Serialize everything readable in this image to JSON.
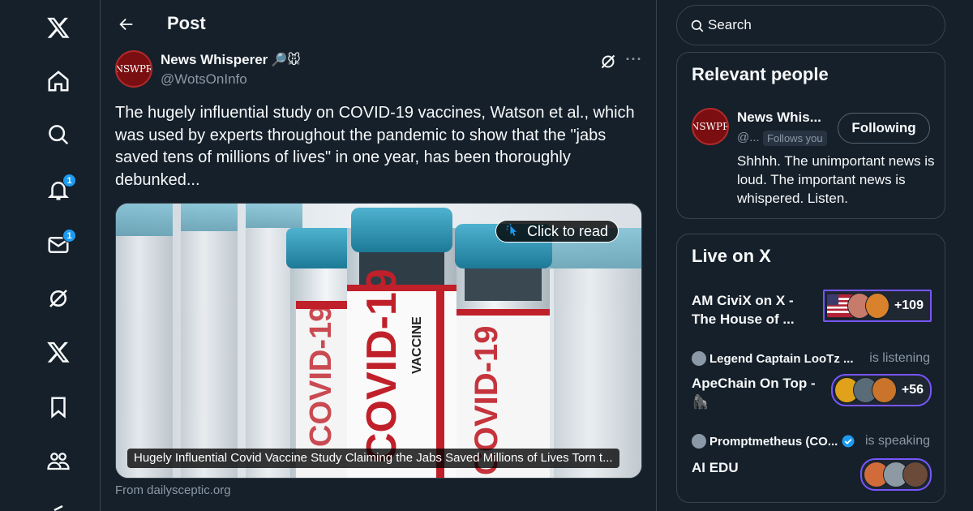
{
  "nav": {
    "items": [
      {
        "name": "x-logo-icon",
        "badge": null
      },
      {
        "name": "home-icon",
        "badge": null
      },
      {
        "name": "search-icon",
        "badge": null
      },
      {
        "name": "notifications-icon",
        "badge": "1"
      },
      {
        "name": "messages-icon",
        "badge": "1"
      },
      {
        "name": "grok-icon",
        "badge": null
      },
      {
        "name": "premium-x-icon",
        "badge": null
      },
      {
        "name": "bookmarks-icon",
        "badge": null
      },
      {
        "name": "communities-icon",
        "badge": null
      }
    ]
  },
  "header": {
    "title": "Post"
  },
  "post": {
    "author_name": "News Whisperer",
    "author_emoji": "🔎🐭",
    "author_handle": "@WotsOnInfo",
    "avatar_text": "NSWPR",
    "text": "The hugely influential study on COVID-19 vaccines, Watson et al., which was used by experts throughout the pandemic to show that the \"jabs saved tens of millions of lives\" in one year, has been thoroughly debunked...",
    "card": {
      "click_to_read": "Click to read",
      "caption": "Hugely Influential Covid Vaccine Study Claiming the Jabs Saved Millions of Lives Torn t...",
      "source": "From dailysceptic.org",
      "vial_labels": [
        "COVID-19",
        "VACCINE"
      ]
    }
  },
  "search": {
    "placeholder": "Search"
  },
  "relevant_people": {
    "title": "Relevant people",
    "person": {
      "name": "News Whis...",
      "handle": "@...",
      "follows_you": "Follows you",
      "button": "Following",
      "avatar_text": "NSWPR",
      "bio": "Shhhh. The unimportant news is loud. The important news is whispered. Listen."
    }
  },
  "live": {
    "title": "Live on X",
    "spaces": [
      {
        "host": "",
        "status": "",
        "title": "AM CiviX on X - The House of ...",
        "count": "+109"
      },
      {
        "host": "Legend Captain LooTz ...",
        "status": "is listening",
        "title": "ApeChain On Top - 🦍",
        "count": "+56"
      },
      {
        "host": "Promptmetheus (CO...",
        "status": "is speaking",
        "title": "AI EDU",
        "count": ""
      }
    ]
  },
  "colors": {
    "background": "#15202b",
    "accent": "#1d9bf0",
    "border": "#38444d",
    "muted_text": "#8b98a5",
    "spaces_purple": "#7856ff"
  }
}
